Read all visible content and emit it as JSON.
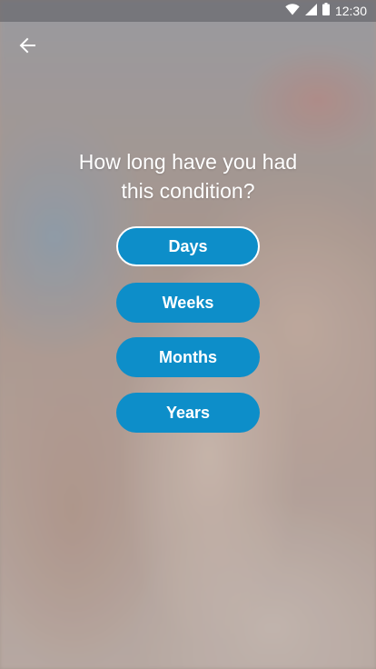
{
  "status_bar": {
    "time": "12:30",
    "icons": [
      "wifi-icon",
      "cellular-signal-icon",
      "battery-icon"
    ]
  },
  "header": {
    "back_icon": "arrow-left-icon"
  },
  "question": {
    "line1": "How long have you had",
    "line2": "this condition?"
  },
  "options": {
    "days": "Days",
    "weeks": "Weeks",
    "months": "Months",
    "years": "Years",
    "selected": "Days"
  },
  "colors": {
    "button": "#0d8ec9",
    "button_text": "#ffffff",
    "selected_border": "#ffffff"
  }
}
